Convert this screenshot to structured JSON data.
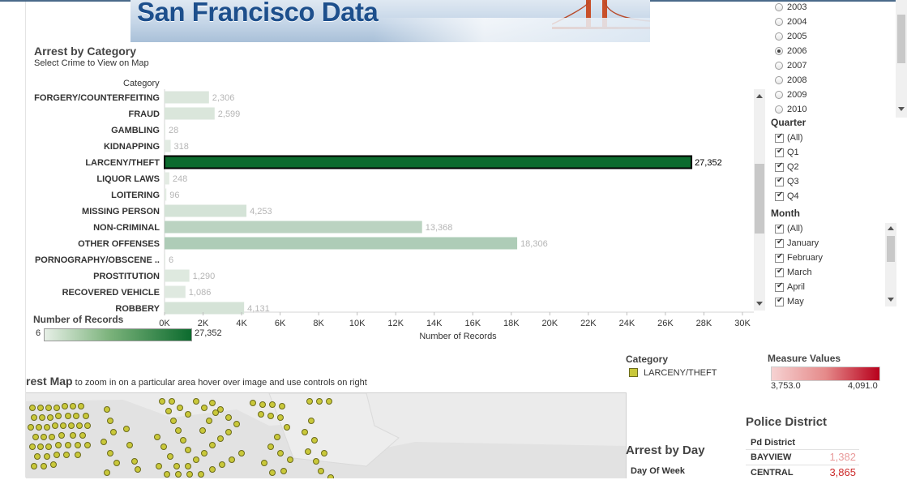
{
  "banner": {
    "title": "San Francisco Data"
  },
  "arrest_by_category": {
    "title": "Arrest by Category",
    "subtitle": "Select Crime to View on Map",
    "category_header": "Category",
    "x_axis_label": "Number of Records"
  },
  "chart_data": {
    "type": "bar",
    "orientation": "horizontal",
    "categories": [
      "FORGERY/COUNTERFEITING",
      "FRAUD",
      "GAMBLING",
      "KIDNAPPING",
      "LARCENY/THEFT",
      "LIQUOR LAWS",
      "LOITERING",
      "MISSING PERSON",
      "NON-CRIMINAL",
      "OTHER OFFENSES",
      "PORNOGRAPHY/OBSCENE ..",
      "PROSTITUTION",
      "RECOVERED VEHICLE",
      "ROBBERY"
    ],
    "values": [
      2306,
      2599,
      28,
      318,
      27352,
      248,
      96,
      4253,
      13368,
      18306,
      6,
      1290,
      1086,
      4131
    ],
    "value_labels": [
      "2,306",
      "2,599",
      "28",
      "318",
      "27,352",
      "248",
      "96",
      "4,253",
      "13,368",
      "18,306",
      "6",
      "1,290",
      "1,086",
      "4,131"
    ],
    "selected": "LARCENY/THEFT",
    "xlabel": "Number of Records",
    "xlim": [
      0,
      30000
    ],
    "ticks": [
      "0K",
      "2K",
      "4K",
      "6K",
      "8K",
      "10K",
      "12K",
      "14K",
      "16K",
      "18K",
      "20K",
      "22K",
      "24K",
      "26K",
      "28K",
      "30K"
    ],
    "colors": {
      "min": "#e4ece4",
      "max": "#0c6b2e",
      "selected_border": "#000000"
    }
  },
  "legend_records": {
    "title": "Number of Records",
    "min": "6",
    "max": "27,352"
  },
  "year_filter": {
    "options": [
      "2003",
      "2004",
      "2005",
      "2006",
      "2007",
      "2008",
      "2009",
      "2010"
    ],
    "selected": "2006"
  },
  "quarter_filter": {
    "title": "Quarter",
    "options": [
      "(All)",
      "Q1",
      "Q2",
      "Q3",
      "Q4"
    ]
  },
  "month_filter": {
    "title": "Month",
    "options": [
      "(All)",
      "January",
      "February",
      "March",
      "April",
      "May"
    ]
  },
  "map_legend": {
    "title": "Category",
    "item": "LARCENY/THEFT",
    "color": "#c9c83a"
  },
  "measure_values": {
    "title": "Measure Values",
    "min": "3,753.0",
    "max": "4,091.0"
  },
  "arrest_map": {
    "title": "rest Map",
    "hint": " to zoom in on a particular area hover over image and use controls on right"
  },
  "arrest_by_day": {
    "title": "Arrest by Day",
    "header": "Day Of Week"
  },
  "police_district": {
    "title": "Police District",
    "header": "Pd District",
    "rows": [
      {
        "name": "BAYVIEW",
        "value": "1,382",
        "color": "#e89a9a"
      },
      {
        "name": "CENTRAL",
        "value": "3,865",
        "color": "#cc2a2a"
      }
    ]
  }
}
